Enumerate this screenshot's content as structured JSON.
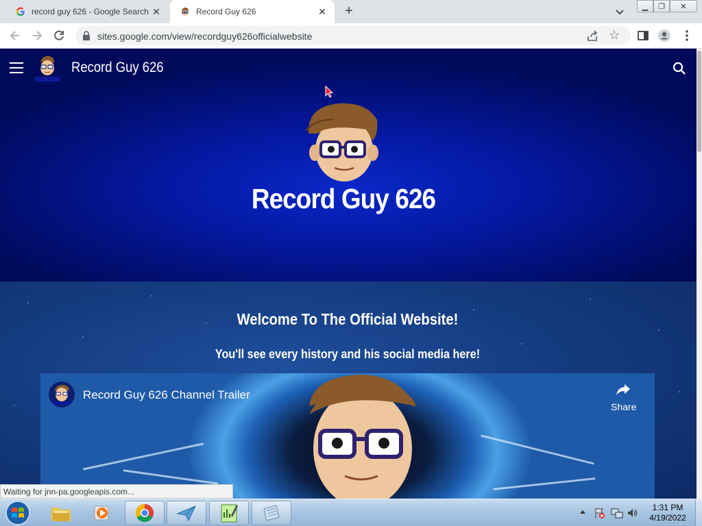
{
  "browser": {
    "tabs": [
      {
        "title": "record guy 626 - Google Search",
        "favicon": "google-g-icon",
        "active": false
      },
      {
        "title": "Record Guy 626",
        "favicon": "record-guy-avatar-icon",
        "active": true
      }
    ],
    "new_tab": "+",
    "url": "sites.google.com/view/recordguy626officialwebsite",
    "status": "Waiting for jnn-pa.googleapis.com..."
  },
  "site": {
    "title": "Record Guy 626",
    "hero_title": "Record Guy 626",
    "welcome": "Welcome To The Official Website!",
    "subline": "You'll see every history and his social media here!",
    "logo_caption": "Record Guy 626"
  },
  "video": {
    "title": "Record Guy 626 Channel Trailer",
    "share_label": "Share"
  },
  "taskbar": {
    "items": [
      "file-explorer-icon",
      "media-player-icon",
      "chrome-icon",
      "mail-app-icon",
      "notepad-chart-icon",
      "notepad-icon"
    ],
    "time": "1:31 PM",
    "date": "4/19/2022"
  },
  "colors": {
    "hero_blue": "#0418a0",
    "section_blue": "#143a7e",
    "chrome_grey": "#dee1e6"
  }
}
